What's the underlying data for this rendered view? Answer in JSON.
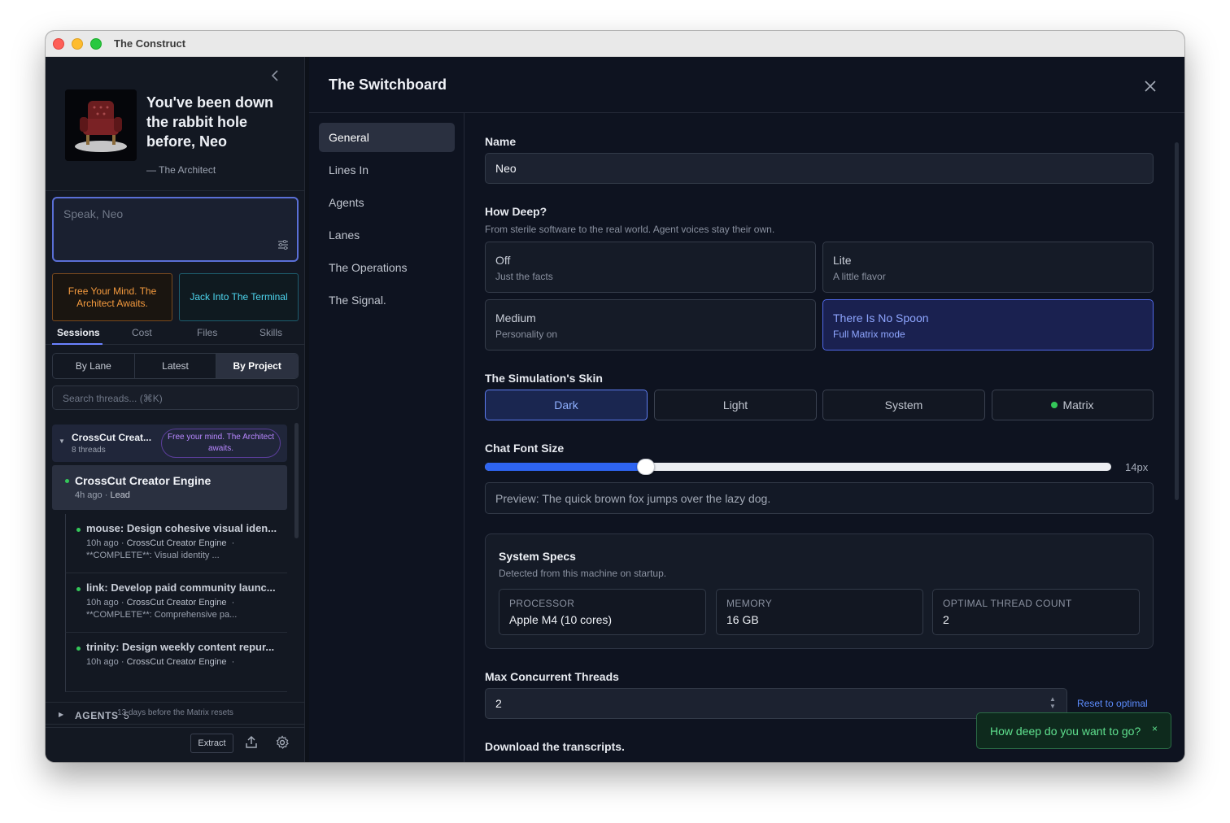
{
  "window": {
    "title": "The Construct"
  },
  "sidebar": {
    "hero_title": "You've been down the rabbit hole before, Neo",
    "hero_attribution": "— The Architect",
    "composer_placeholder": "Speak, Neo",
    "cta_left": "Free Your Mind. The Architect Awaits.",
    "cta_right": "Jack Into The Terminal",
    "tabs": [
      "Sessions",
      "Cost",
      "Files",
      "Skills"
    ],
    "active_tab": "Sessions",
    "segments": [
      "By Lane",
      "Latest",
      "By Project"
    ],
    "active_segment": "By Project",
    "search_placeholder": "Search threads... (⌘K)",
    "group": {
      "name": "CrossCut Creat...",
      "count": "8 threads",
      "pill": "Free your mind. The Architect awaits."
    },
    "selected_thread": {
      "name": "CrossCut Creator Engine",
      "age": "4h ago",
      "sep": "·",
      "role": "Lead"
    },
    "children": [
      {
        "name": "mouse: Design cohesive visual iden...",
        "age": "10h ago",
        "sep": "·",
        "engine": "CrossCut Creator Engine",
        "trail": "·",
        "desc": "**COMPLETE**: Visual identity ..."
      },
      {
        "name": "link: Develop paid community launc...",
        "age": "10h ago",
        "sep": "·",
        "engine": "CrossCut Creator Engine",
        "trail": "·",
        "desc": "**COMPLETE**: Comprehensive pa..."
      },
      {
        "name": "trinity: Design weekly content repur...",
        "age": "10h ago",
        "sep": "·",
        "engine": "CrossCut Creator Engine",
        "trail": "·",
        "desc": ""
      }
    ],
    "agents_label": "AGENTS",
    "agents_count": "5",
    "reset_note": "13 days before the Matrix resets",
    "extract_label": "Extract"
  },
  "panel": {
    "title": "The Switchboard",
    "nav": [
      "General",
      "Lines In",
      "Agents",
      "Lanes",
      "The Operations",
      "The Signal."
    ],
    "active_nav": "General",
    "name_label": "Name",
    "name_value": "Neo",
    "depth_label": "How Deep?",
    "depth_sub": "From sterile software to the real world. Agent voices stay their own.",
    "depth_options": [
      {
        "title": "Off",
        "desc": "Just the facts"
      },
      {
        "title": "Lite",
        "desc": "A little flavor"
      },
      {
        "title": "Medium",
        "desc": "Personality on"
      },
      {
        "title": "There Is No Spoon",
        "desc": "Full Matrix mode"
      }
    ],
    "depth_selected": "There Is No Spoon",
    "skin_label": "The Simulation's Skin",
    "skins": [
      "Dark",
      "Light",
      "System",
      "Matrix"
    ],
    "skin_selected": "Dark",
    "font_label": "Chat Font Size",
    "font_value": "14px",
    "font_slider_fraction": 0.257,
    "preview_text": "Preview: The quick brown fox jumps over the lazy dog.",
    "specs": {
      "title": "System Specs",
      "sub": "Detected from this machine on startup.",
      "items": [
        {
          "key": "PROCESSOR",
          "value": "Apple M4 (10 cores)"
        },
        {
          "key": "MEMORY",
          "value": "16 GB"
        },
        {
          "key": "OPTIMAL THREAD COUNT",
          "value": "2"
        }
      ]
    },
    "threads_label": "Max Concurrent Threads",
    "threads_value": "2",
    "reset_label": "Reset to optimal",
    "download_label": "Download the transcripts."
  },
  "toast": {
    "text": "How deep do you want to go?",
    "close": "×"
  },
  "colors": {
    "accent": "#5d7cf0",
    "cta_orange": "#f49a3e",
    "cta_cyan": "#4ed6ef",
    "toast_green": "#5fe08e",
    "status_green": "#34c759"
  }
}
